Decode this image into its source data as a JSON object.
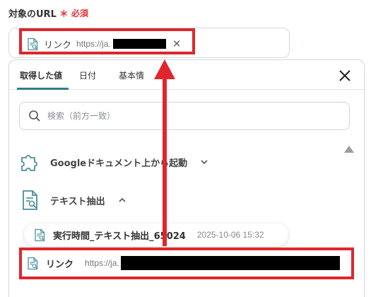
{
  "field": {
    "label": "対象のURL",
    "required_mark": "＊",
    "required_text": "必須"
  },
  "token": {
    "label": "リンク",
    "url": "https://ja.",
    "close": "✕"
  },
  "tabs": [
    {
      "label": "取得した値",
      "active": true
    },
    {
      "label": "日付",
      "active": false
    },
    {
      "label": "基本情",
      "active": false
    }
  ],
  "search": {
    "placeholder": "検索（前方一致）"
  },
  "groups": [
    {
      "label": "Googleドキュメント上から起動",
      "expanded": false,
      "icon": "puzzle-icon"
    },
    {
      "label": "テキスト抽出",
      "expanded": true,
      "icon": "document-search-icon"
    }
  ],
  "step_pill": {
    "name": "実行時間_テキスト抽出_65024",
    "date": "2025-10-06 15:32"
  },
  "value_row": {
    "label": "リンク",
    "url": "https://ja."
  },
  "colors": {
    "accent": "#2d7f8a",
    "highlight": "#e0262c",
    "required": "#e0323a"
  }
}
